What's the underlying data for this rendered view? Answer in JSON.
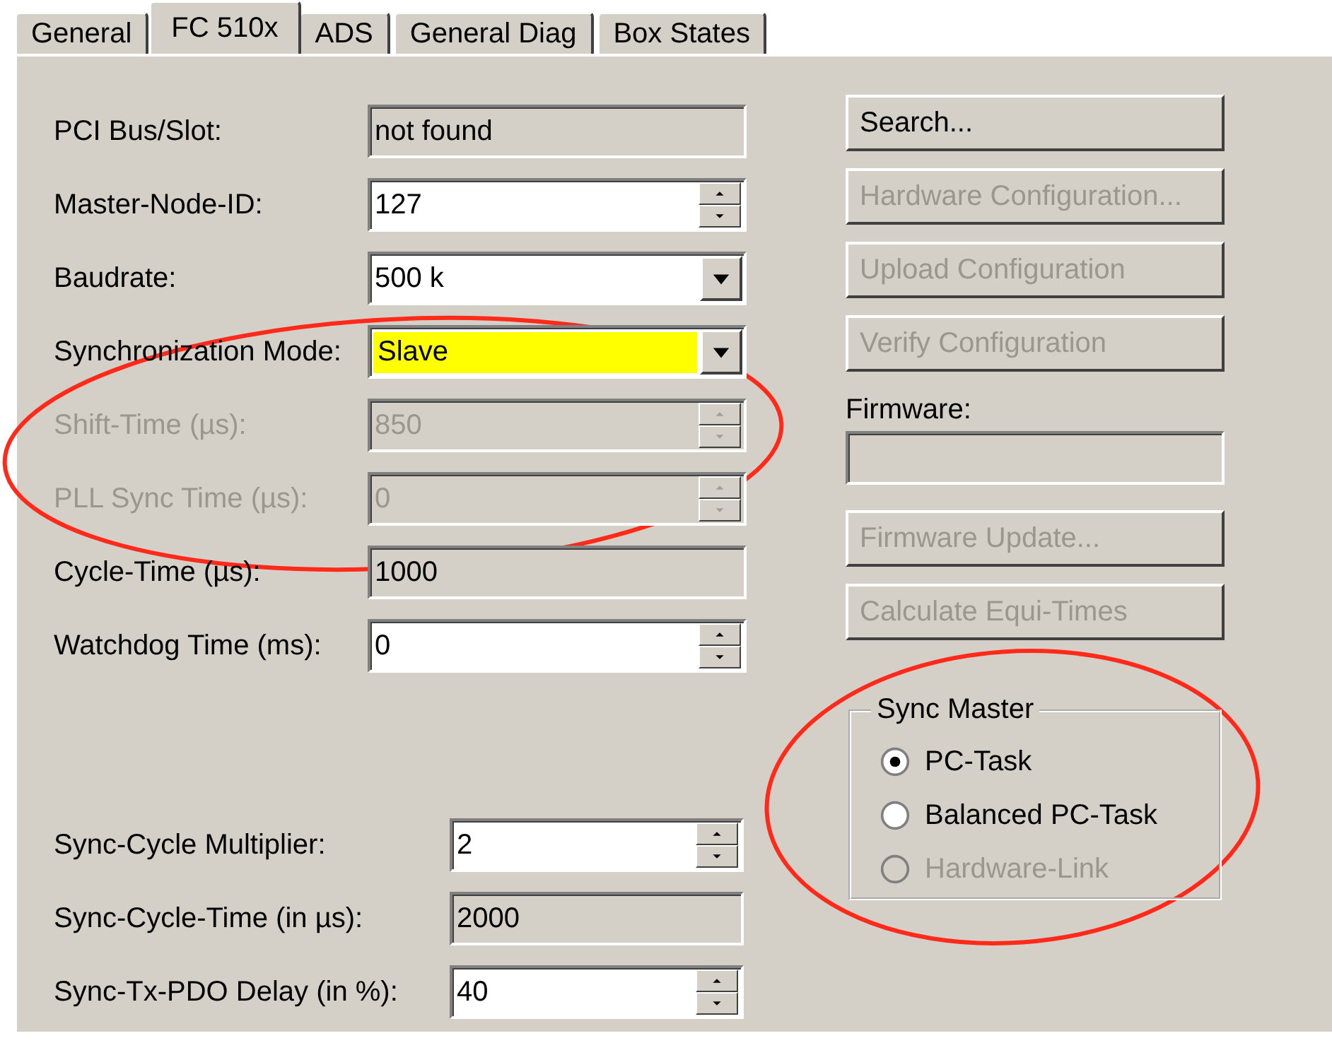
{
  "tabs": [
    {
      "label": "General",
      "selected": false
    },
    {
      "label": "FC 510x",
      "selected": true
    },
    {
      "label": "ADS",
      "selected": false
    },
    {
      "label": "General Diag",
      "selected": false
    },
    {
      "label": "Box States",
      "selected": false
    }
  ],
  "fields": [
    {
      "label": "PCI Bus/Slot:",
      "kind": "readonly",
      "value": "not found",
      "disabled": false,
      "highlighted": false
    },
    {
      "label": "Master-Node-ID:",
      "kind": "spin",
      "value": "127",
      "disabled": false,
      "highlighted": false
    },
    {
      "label": "Baudrate:",
      "kind": "combo",
      "value": "500 k",
      "disabled": false,
      "highlighted": false
    },
    {
      "label": "Synchronization Mode:",
      "kind": "combo",
      "value": "Slave",
      "disabled": false,
      "highlighted": true
    },
    {
      "label": "Shift-Time (µs):",
      "kind": "spin",
      "value": "850",
      "disabled": true,
      "highlighted": false
    },
    {
      "label": "PLL Sync Time (µs):",
      "kind": "spin",
      "value": "0",
      "disabled": true,
      "highlighted": false
    },
    {
      "label": "Cycle-Time (µs):",
      "kind": "readonly",
      "value": "1000",
      "disabled": false,
      "highlighted": false
    },
    {
      "label": "Watchdog Time (ms):",
      "kind": "spin",
      "value": "0",
      "disabled": false,
      "highlighted": false
    }
  ],
  "sync_fields": [
    {
      "label": "Sync-Cycle Multiplier:",
      "kind": "spin",
      "value": "2",
      "disabled": false,
      "highlighted": false
    },
    {
      "label": "Sync-Cycle-Time (in µs):",
      "kind": "readonly",
      "value": "2000",
      "disabled": false,
      "highlighted": false
    },
    {
      "label": "Sync-Tx-PDO Delay (in %):",
      "kind": "spin",
      "value": "40",
      "disabled": false,
      "highlighted": false
    }
  ],
  "actions": [
    {
      "label": "Search...",
      "disabled": false
    },
    {
      "label": "Hardware Configuration...",
      "disabled": true
    },
    {
      "label": "Upload Configuration",
      "disabled": true
    },
    {
      "label": "Verify Configuration",
      "disabled": true
    }
  ],
  "firmware": {
    "label": "Firmware:"
  },
  "firmware_actions": [
    {
      "label": "Firmware Update...",
      "disabled": true
    },
    {
      "label": "Calculate Equi-Times",
      "disabled": true
    }
  ],
  "sync_master": {
    "title": "Sync Master",
    "options": [
      {
        "label": "PC-Task",
        "selected": true,
        "disabled": false
      },
      {
        "label": "Balanced PC-Task",
        "selected": false,
        "disabled": false
      },
      {
        "label": "Hardware-Link",
        "selected": false,
        "disabled": true
      }
    ]
  }
}
